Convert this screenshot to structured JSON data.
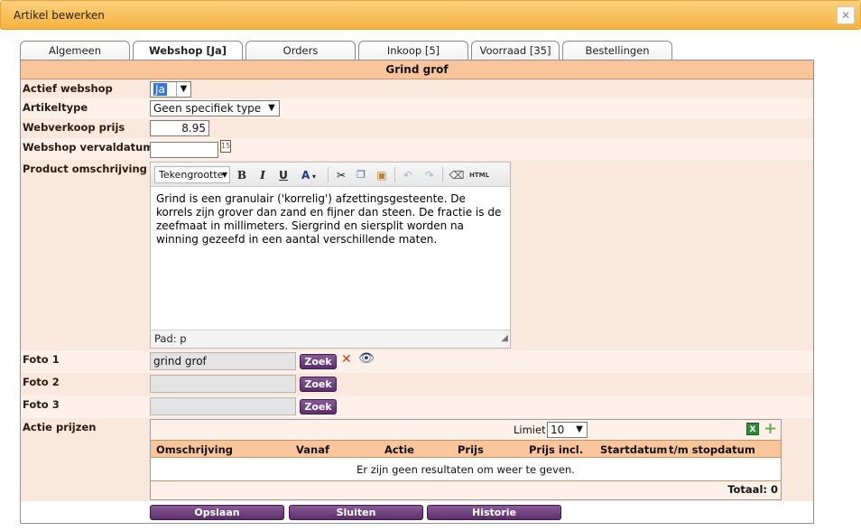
{
  "window": {
    "title": "Artikel bewerken"
  },
  "tabs": [
    {
      "label": "Algemeen"
    },
    {
      "label": "Webshop [Ja]"
    },
    {
      "label": "Orders"
    },
    {
      "label": "Inkoop [5]"
    },
    {
      "label": "Voorraad [35]"
    },
    {
      "label": "Bestellingen"
    }
  ],
  "panel": {
    "heading": "Grind grof"
  },
  "fields": {
    "actief_webshop": {
      "label": "Actief webshop",
      "value": "Ja"
    },
    "artikeltype": {
      "label": "Artikeltype",
      "value": "Geen specifiek type"
    },
    "webverkoop_prijs": {
      "label": "Webverkoop prijs",
      "value": "8.95"
    },
    "webshop_vervaldatum": {
      "label": "Webshop vervaldatum",
      "value": ""
    },
    "product_omschrijving": {
      "label": "Product omschrijving"
    },
    "foto1": {
      "label": "Foto 1",
      "value": "grind grof"
    },
    "foto2": {
      "label": "Foto 2",
      "value": ""
    },
    "foto3": {
      "label": "Foto 3",
      "value": ""
    },
    "actie_prijzen": {
      "label": "Actie prijzen"
    }
  },
  "editor": {
    "font_size_label": "Tekengrootte",
    "text": "Grind is een granulair ('korrelig') afzettingsgesteente. De korrels zijn grover dan zand en fijner dan steen. De fractie is de zeefmaat in millimeters. Siergrind en siersplit worden na winning gezeefd in een aantal verschillende maten.",
    "path": "Pad: p"
  },
  "buttons": {
    "zoek": "Zoek",
    "opslaan": "Opslaan",
    "sluiten": "Sluiten",
    "historie": "Historie"
  },
  "grid": {
    "limit_label": "Limiet",
    "limit_value": "10",
    "columns": [
      "Omschrijving",
      "Vanaf",
      "Actie",
      "Prijs",
      "Prijs incl.",
      "Startdatum",
      "t/m stopdatum"
    ],
    "empty_message": "Er zijn geen resultaten om weer te geven.",
    "total": "Totaal: 0"
  },
  "colors": {
    "title_bar": "#f5b33f",
    "panel_header": "#fbc59b",
    "row_bg": "#fbe8dd",
    "button": "#5b2e6b"
  }
}
